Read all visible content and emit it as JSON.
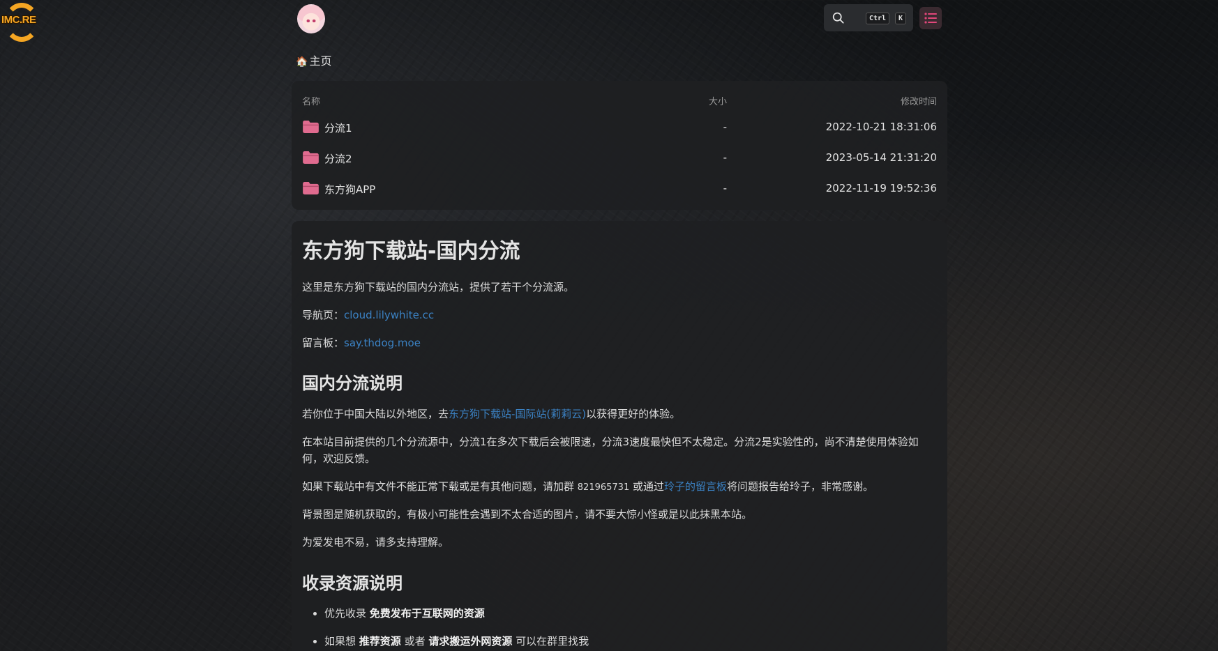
{
  "site_logo": {
    "text": "IMC.RE",
    "icon": "imc-refresh-logo"
  },
  "header": {
    "avatar": "anime-avatar",
    "search": {
      "icon": "search-icon",
      "shortcut_ctrl": "Ctrl",
      "shortcut_key": "K"
    },
    "menu": {
      "icon": "list-menu-icon",
      "color": "#e2477a"
    }
  },
  "breadcrumb": {
    "icon": "🏠",
    "label": "主页"
  },
  "files": {
    "columns": {
      "name": "名称",
      "size": "大小",
      "modified": "修改时间"
    },
    "rows": [
      {
        "name": "分流1",
        "size": "-",
        "modified": "2022-10-21 18:31:06"
      },
      {
        "name": "分流2",
        "size": "-",
        "modified": "2023-05-14 21:31:20"
      },
      {
        "name": "东方狗APP",
        "size": "-",
        "modified": "2022-11-19 19:52:36"
      }
    ],
    "folder_color": "#e06b8f"
  },
  "readme": {
    "title": "东方狗下载站-国内分流",
    "intro": "这里是东方狗下载站的国内分流站，提供了若干个分流源。",
    "nav_label": "导航页：",
    "nav_link": "cloud.lilywhite.cc",
    "board_label": "留言板：",
    "board_link": "say.thdog.moe",
    "section1": {
      "heading": "国内分流说明",
      "p1_pre": "若你位于中国大陆以外地区，去",
      "p1_link": "东方狗下载站-国际站(莉莉云)",
      "p1_post": "以获得更好的体验。",
      "p2": "在本站目前提供的几个分流源中，分流1在多次下载后会被限速，分流3速度最快但不太稳定。分流2是实验性的，尚不清楚使用体验如何，欢迎反馈。",
      "p3_pre": "如果下载站中有文件不能正常下载或是有其他问题，请加群 ",
      "p3_code": "821965731",
      "p3_mid": " 或通过",
      "p3_link": "玲子的留言板",
      "p3_post": "将问题报告给玲子，非常感谢。",
      "p4": "背景图是随机获取的，有极小可能性会遇到不太合适的图片，请不要大惊小怪或是以此抹黑本站。",
      "p5": "为爱发电不易，请多支持理解。"
    },
    "section2": {
      "heading": "收录资源说明",
      "item1_pre": "优先收录 ",
      "item1_bold": "免费发布于互联网的资源",
      "item2_pre": "如果想 ",
      "item2_bold1": "推荐资源",
      "item2_mid": " 或者 ",
      "item2_bold2": "请求搬运外网资源",
      "item2_post": " 可以在群里找我"
    }
  },
  "colors": {
    "accent": "#e2477a",
    "link": "#3b82c4",
    "panel": "#1e2022"
  }
}
